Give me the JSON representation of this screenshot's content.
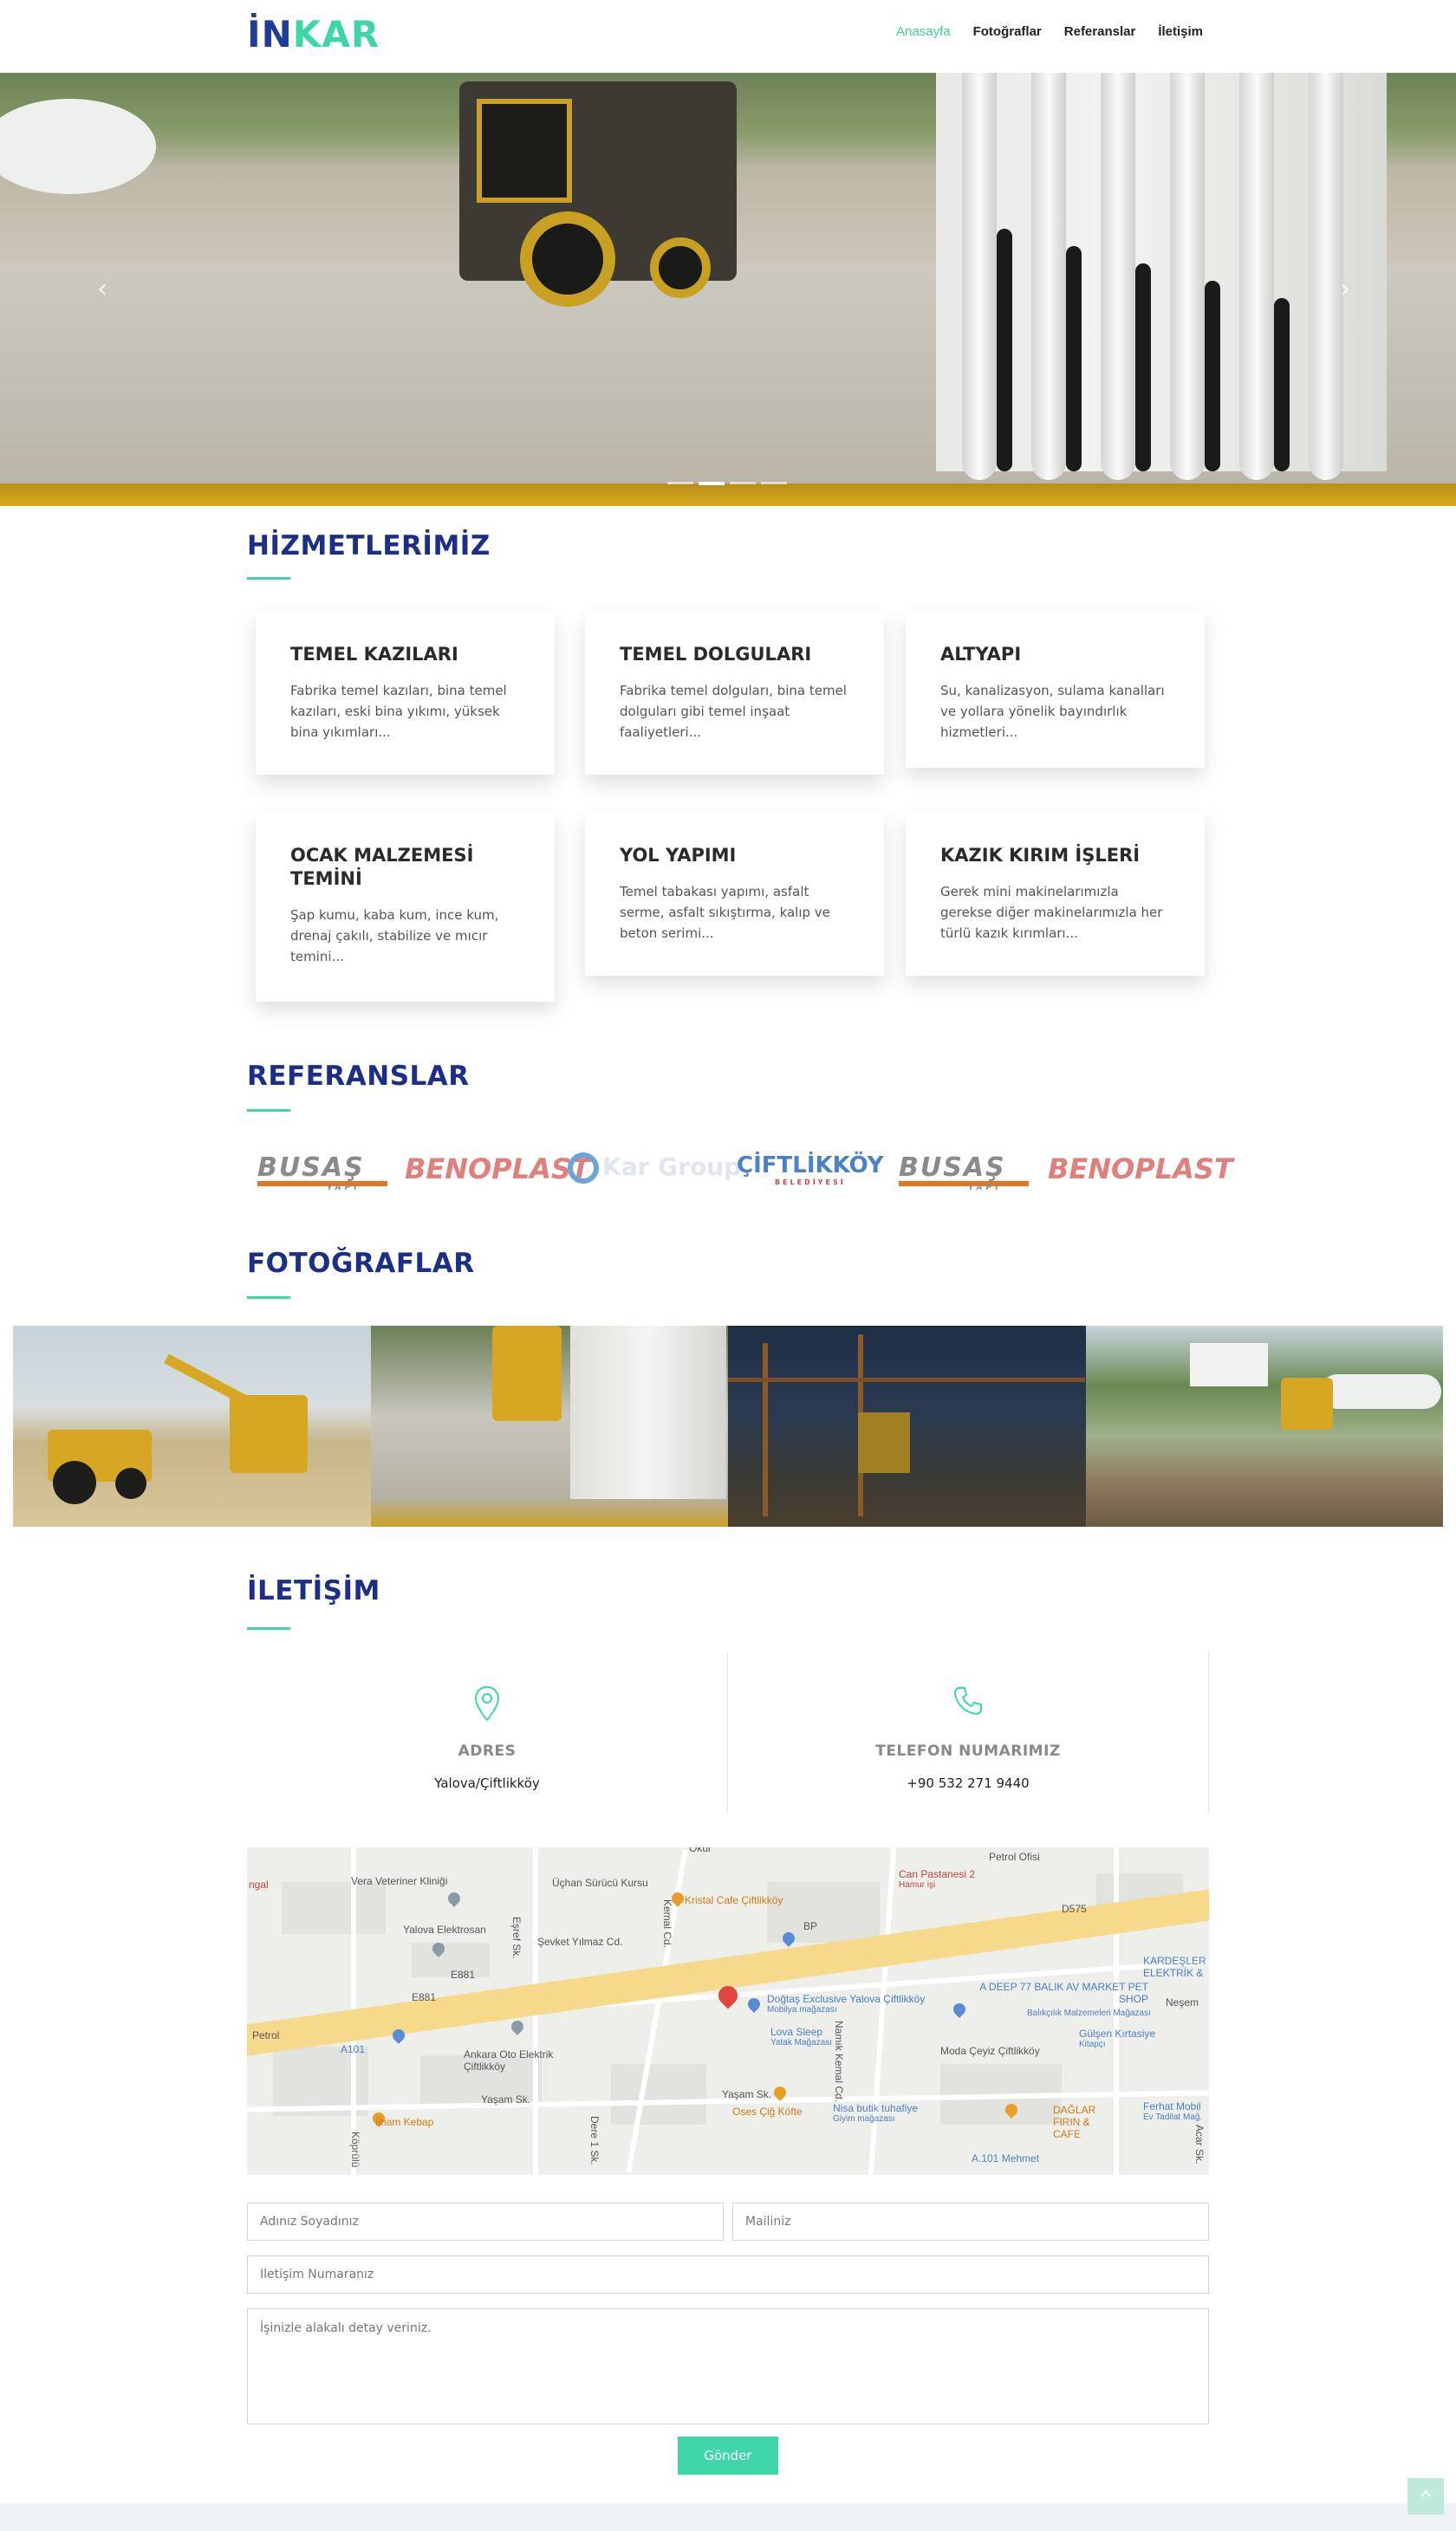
{
  "brand": {
    "logo_part1": "İN",
    "logo_part2": "KAR"
  },
  "nav": {
    "items": [
      {
        "label": "Anasayfa",
        "active": true
      },
      {
        "label": "Fotoğraflar",
        "active": false
      },
      {
        "label": "Referanslar",
        "active": false
      },
      {
        "label": "İletişim",
        "active": false
      }
    ]
  },
  "hero": {
    "slide_count": 4,
    "active_slide": 2,
    "prev_icon": "chevron-left-icon",
    "next_icon": "chevron-right-icon"
  },
  "services": {
    "title": "HİZMETLERİMİZ",
    "items": [
      {
        "title": "TEMEL KAZILARI",
        "text": "Fabrika temel kazıları, bina temel kazıları, eski bina yıkımı, yüksek bina yıkımları..."
      },
      {
        "title": "TEMEL DOLGULARI",
        "text": "Fabrika temel dolguları, bina temel dolguları gibi temel inşaat faaliyetleri..."
      },
      {
        "title": "ALTYAPI",
        "text": "Su, kanalizasyon, sulama kanalları ve yollara yönelik bayındırlık hizmetleri..."
      },
      {
        "title": "OCAK MALZEMESİ TEMİNİ",
        "text": "Şap kumu, kaba kum, ince kum, drenaj çakılı, stabilize ve mıcır temini..."
      },
      {
        "title": "YOL YAPIMI",
        "text": "Temel tabakası yapımı, asfalt serme, asfalt sıkıştırma, kalıp ve beton serimi..."
      },
      {
        "title": "KAZIK KIRIM İŞLERİ",
        "text": "Gerek mini makinelarımızla gerekse diğer makinelarımızla her türlü kazık kırımları..."
      }
    ]
  },
  "references": {
    "title": "REFERANSLAR",
    "logos": [
      {
        "name": "BUSAŞ",
        "sub": "YAPI"
      },
      {
        "name": "BENOPLAST"
      },
      {
        "name": "Kar Group"
      },
      {
        "name": "ÇİFTLİKKÖY",
        "sub": "BELEDİYESİ"
      },
      {
        "name": "BUSAŞ",
        "sub": "YAPI"
      },
      {
        "name": "BENOPLAST"
      }
    ]
  },
  "photos": {
    "title": "FOTOĞRAFLAR",
    "count": 4
  },
  "contact": {
    "title": "İLETİŞİM",
    "address_label": "ADRES",
    "address_value": "Yalova/Çiftlikköy",
    "address_icon": "map-pin-icon",
    "phone_label": "TELEFON NUMARIMIZ",
    "phone_value": "+90 532 271 9440",
    "phone_icon": "phone-icon"
  },
  "map": {
    "labels": {
      "vet": "Vera Veteriner Kliniği",
      "elektrosan": "Yalova Elektrosan",
      "surucu": "Üçhan Sürücü Kursu",
      "sevket": "Şevket Yılmaz Cd.",
      "kristal": "Kristal Cafe Çiftlikköy",
      "can": "Can Pastanesi 2",
      "can_sub": "Hamur işi",
      "petrol_ofisi": "Petrol Ofisi",
      "dogtas": "Doğtaş Exclusive Yalova Çiftlikköy",
      "dogtas_sub": "Mobilya mağazası",
      "deep77": "A DEEP 77 BALIK AV MARKET PET SHOP",
      "deep77_sub": "Balıkçılık Malzemeleri Mağazası",
      "kardesler": "KARDEŞLER ELEKTRİK &",
      "gulsen": "Gülşen Kırtasiye",
      "gulsen_sub": "Kitapçı",
      "nesem": "Neşem",
      "ankara": "Ankara Oto Elektrik Çiftlikköy",
      "lova": "Lova Sleep",
      "lova_sub": "Yatak Mağazası",
      "moda": "Moda Çeyiz Çiftlikköy",
      "a101": "A101",
      "petrol": "Petrol",
      "ilham": "İlham Kebap",
      "yasam1": "Yaşam Sk.",
      "yasam2": "Yaşam Sk.",
      "oses": "Oses Çiğ Köfte",
      "nisa": "Nisa butik tuhafiye",
      "nisa_sub": "Giyim mağazası",
      "daglar": "DAĞLAR FIRIN & CAFE",
      "ferhat": "Ferhat Mobil",
      "ferhat_sub": "Ev Tadilat Mağ.",
      "a101m": "A.101 Mehmet",
      "namik": "Namık Kemal Cd.",
      "kemal": "Kemal Cd.",
      "esref": "Eşref Sk.",
      "dere": "Dere 1 Sk.",
      "koprulu": "Köprülü",
      "acar": "Acar Sk.",
      "bp": "BP",
      "ngal": "ngal",
      "e881a": "E881",
      "e881b": "E881",
      "d575": "D575",
      "okul": "Okul"
    }
  },
  "form": {
    "name_placeholder": "Adınız Soyadınız",
    "mail_placeholder": "Mailiniz",
    "phone_placeholder": "İletişim Numaranız",
    "detail_placeholder": "İşinizle alakalı detay veriniz.",
    "submit_label": "Gönder"
  },
  "scroll_top_icon": "chevron-up-icon",
  "colors": {
    "brand_blue": "#1c2f86",
    "accent_green": "#3ed6a8"
  }
}
